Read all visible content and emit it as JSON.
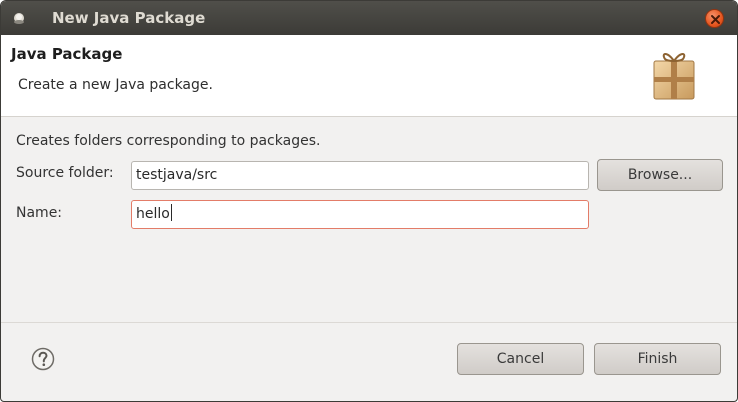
{
  "window": {
    "title": "New Java Package",
    "colors": {
      "titlebar": "#3c3b37",
      "close_button": "#e6561f",
      "dialog_bg": "#f2f1f0"
    }
  },
  "banner": {
    "title": "Java Package",
    "description": "Create a new Java package.",
    "icon": "package-icon"
  },
  "form": {
    "hint": "Creates folders corresponding to packages.",
    "source_folder": {
      "label": "Source folder:",
      "value": "testjava/src"
    },
    "browse_label": "Browse...",
    "name": {
      "label": "Name:",
      "value": "hello"
    }
  },
  "footer": {
    "help_icon": "help-icon",
    "cancel_label": "Cancel",
    "finish_label": "Finish"
  }
}
